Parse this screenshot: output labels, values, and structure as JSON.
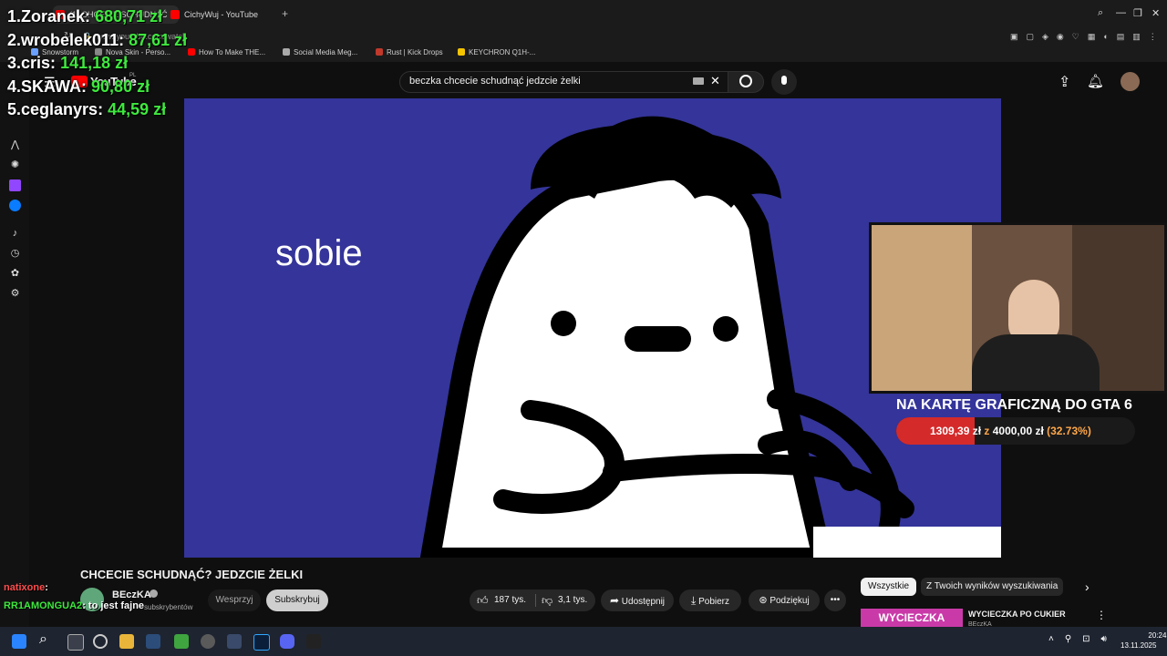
{
  "browser": {
    "tabs": [
      {
        "label": "(1) CHCECIE SCHUDNĄĆ",
        "favicon_color": "#ff0000",
        "active": true
      },
      {
        "label": "CichyWuj - YouTube",
        "favicon_color": "#ff0000",
        "active": false
      }
    ],
    "new_tab_icon": "plus-icon",
    "url": "www.youtube.com/watch",
    "bookmarks": [
      {
        "label": "Snowstorm",
        "icon_color": "#6aa0ff"
      },
      {
        "label": "Nova Skin - Perso...",
        "icon_color": "#888888"
      },
      {
        "label": "How To Make THE...",
        "icon_color": "#ff0000"
      },
      {
        "label": "Social Media Meg...",
        "icon_color": "#aaaaaa"
      },
      {
        "label": "Rust | Kick Drops",
        "icon_color": "#c0392b"
      },
      {
        "label": "KEYCHRON Q1H-...",
        "icon_color": "#f5c400"
      }
    ]
  },
  "youtube": {
    "logo": "YouTube",
    "logo_region": "PL",
    "search": {
      "query": "beczka chcecie schudnąć jedzcie żelki"
    },
    "video": {
      "caption_text": "sobie",
      "title": "CHCECIE SCHUDNĄĆ? JEDZCIE ŻELKI"
    },
    "channel": {
      "name": "BEczKA",
      "subscribers": "subskrybentów"
    },
    "buttons": {
      "support": "Wesprzyj",
      "subscribe": "Subskrybuj",
      "likes": "187 tys.",
      "dislikes": "3,1 tys.",
      "share": "Udostępnij",
      "download": "Pobierz",
      "thanks": "Podziękuj"
    },
    "chips": {
      "all": "Wszystkie",
      "yours": "Z Twoich wyników wyszukiwania"
    },
    "recommended": {
      "thumb_text": "WYCIECZKA",
      "title": "WYCIECZKA PO CUKIER",
      "channel": "BEczKA"
    }
  },
  "stream_overlay": {
    "leaderboard": [
      {
        "rank": "1.",
        "name": "Zoranek:",
        "amount": "680,71 zł"
      },
      {
        "rank": "2.",
        "name": "wrobelek011:",
        "amount": "87,61 zł"
      },
      {
        "rank": "3.",
        "name": "cris:",
        "amount": "141,18 zł"
      },
      {
        "rank": "4.",
        "name": "SKAWA:",
        "amount": "90,80 zł"
      },
      {
        "rank": "5.",
        "name": "ceglanyrs:",
        "amount": "44,59 zł"
      }
    ],
    "goal": {
      "title": "NA KARTĘ GRAFICZNĄ DO GTA 6",
      "current": "1309,39 zł",
      "separator": "z",
      "target": "4000,00 zł",
      "percent_label": "(32.73%)",
      "progress_fraction": 0.3273
    },
    "chat": [
      {
        "user": "natixone",
        "message": ":",
        "color": "#ff4d4d"
      },
      {
        "user": "RR1AMONGUA2",
        "message": ": to jest fajne",
        "color": "#3ee83e"
      }
    ]
  },
  "taskbar": {
    "time": "20:24",
    "date": "13.11.2025"
  }
}
